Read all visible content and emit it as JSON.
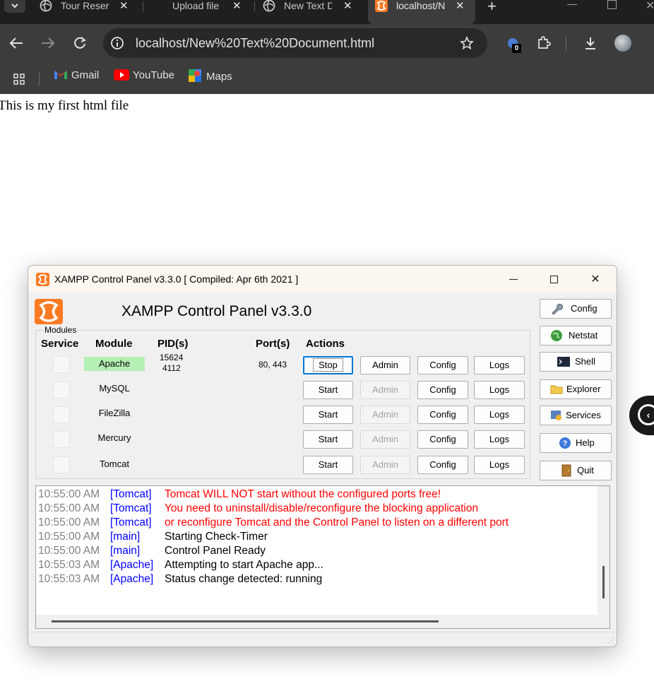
{
  "browser": {
    "tabs": [
      {
        "title": "Tour Reser"
      },
      {
        "title": "Upload file"
      },
      {
        "title": "New Text D"
      },
      {
        "title": "localhost/N"
      }
    ],
    "new_tab": "+",
    "close_glyph": "✕",
    "url": "localhost/New%20Text%20Document.html",
    "extension_badge": "0",
    "bookmarks": [
      {
        "label": "Gmail"
      },
      {
        "label": "YouTube"
      },
      {
        "label": "Maps"
      }
    ]
  },
  "page": {
    "text": "This is my first html file"
  },
  "xampp": {
    "window_title": "XAMPP Control Panel v3.3.0   [ Compiled: Apr 6th 2021 ]",
    "heading": "XAMPP Control Panel v3.3.0",
    "modules_legend": "Modules",
    "columns": {
      "service": "Service",
      "module": "Module",
      "pids": "PID(s)",
      "ports": "Port(s)",
      "actions": "Actions"
    },
    "modules": [
      {
        "name": "Apache",
        "pid1": "15624",
        "pid2": "4112",
        "ports": "80, 443",
        "action": "Stop",
        "admin": "Admin",
        "config": "Config",
        "logs": "Logs",
        "running": true
      },
      {
        "name": "MySQL",
        "action": "Start",
        "admin": "Admin",
        "config": "Config",
        "logs": "Logs",
        "running": false
      },
      {
        "name": "FileZilla",
        "action": "Start",
        "admin": "Admin",
        "config": "Config",
        "logs": "Logs",
        "running": false
      },
      {
        "name": "Mercury",
        "action": "Start",
        "admin": "Admin",
        "config": "Config",
        "logs": "Logs",
        "running": false
      },
      {
        "name": "Tomcat",
        "action": "Start",
        "admin": "Admin",
        "config": "Config",
        "logs": "Logs",
        "running": false
      }
    ],
    "side_buttons": [
      {
        "label": "Config",
        "icon": "wrench-icon"
      },
      {
        "label": "Netstat",
        "icon": "globe-icon"
      },
      {
        "label": "Shell",
        "icon": "terminal-icon"
      },
      {
        "label": "Explorer",
        "icon": "folder-icon"
      },
      {
        "label": "Services",
        "icon": "services-icon"
      },
      {
        "label": "Help",
        "icon": "help-icon"
      },
      {
        "label": "Quit",
        "icon": "door-icon"
      }
    ],
    "log": [
      {
        "time": "10:55:00 AM",
        "source": "[Tomcat]",
        "message": "Tomcat WILL NOT start without the configured ports free!",
        "level": "error"
      },
      {
        "time": "10:55:00 AM",
        "source": "[Tomcat]",
        "message": "You need to uninstall/disable/reconfigure the blocking application",
        "level": "error"
      },
      {
        "time": "10:55:00 AM",
        "source": "[Tomcat]",
        "message": "or reconfigure Tomcat and the Control Panel to listen on a different port",
        "level": "error"
      },
      {
        "time": "10:55:00 AM",
        "source": "[main]",
        "message": "Starting Check-Timer",
        "level": "info"
      },
      {
        "time": "10:55:00 AM",
        "source": "[main]",
        "message": "Control Panel Ready",
        "level": "info"
      },
      {
        "time": "10:55:03 AM",
        "source": "[Apache]",
        "message": "Attempting to start Apache app...",
        "level": "info"
      },
      {
        "time": "10:55:03 AM",
        "source": "[Apache]",
        "message": "Status change detected: running",
        "level": "info"
      }
    ]
  },
  "colors": {
    "chrome_dark": "#1f1f1f",
    "chrome_toolbar": "#3c3c3c",
    "xampp_orange": "#fb7a24",
    "running_green": "#b4f0b4",
    "log_error": "#ff0000",
    "log_source": "#0000ff"
  }
}
